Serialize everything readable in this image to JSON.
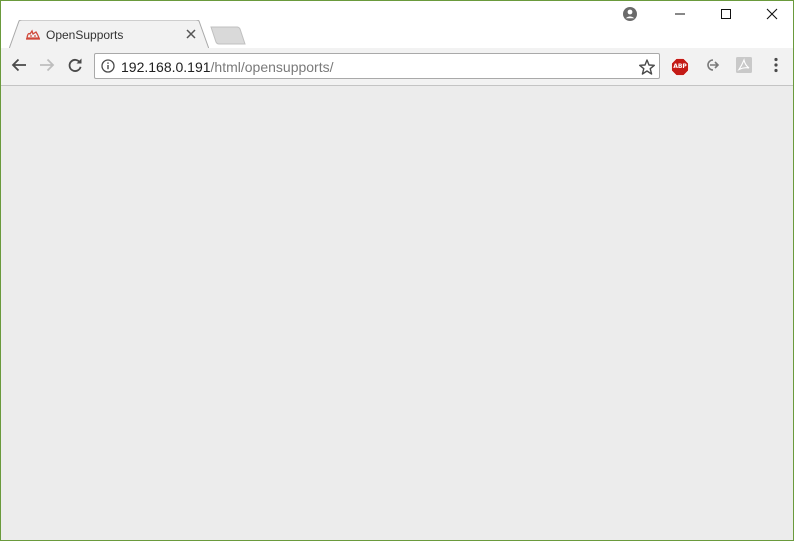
{
  "tab": {
    "title": "OpenSupports",
    "favicon": "opensupports-logo-icon"
  },
  "window_controls": {
    "profile": "profile-icon",
    "minimize": "minimize-icon",
    "maximize": "maximize-icon",
    "close": "close-icon"
  },
  "toolbar": {
    "back": "back-arrow-icon",
    "forward": "forward-arrow-icon",
    "reload": "reload-icon"
  },
  "address_bar": {
    "host": "192.168.0.191",
    "path": "/html/opensupports/",
    "info_icon": "info-icon",
    "bookmark_icon": "star-icon"
  },
  "extensions": {
    "adblock_label": "ABP",
    "adblock_color": "#c41a16",
    "second": "share-arrow-icon",
    "third": "pdf-icon",
    "menu": "kebab-menu-icon"
  },
  "colors": {
    "content_background": "#ececec",
    "window_border": "#6a9a3c"
  }
}
